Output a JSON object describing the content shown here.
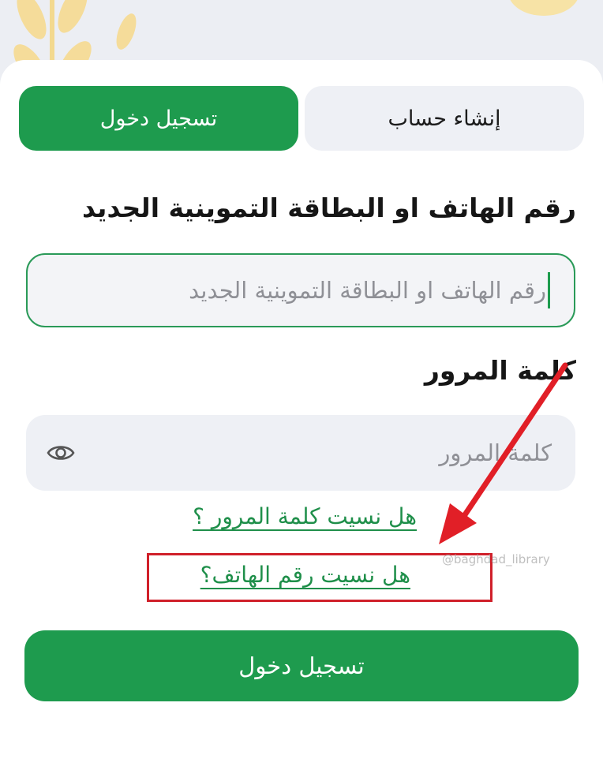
{
  "tabs": {
    "login": "تسجيل دخول",
    "signup": "إنشاء حساب"
  },
  "form": {
    "phone_label": "رقم الهاتف او البطاقة التموينية الجديد",
    "phone_placeholder": "رقم الهاتف او البطاقة التموينية الجديد",
    "password_label": "كلمة المرور",
    "password_placeholder": "كلمة المرور"
  },
  "links": {
    "forgot_password": "هل نسيت كلمة المرور ؟",
    "forgot_phone": "هل نسيت رقم الهاتف؟"
  },
  "login_button": "تسجيل دخول",
  "watermark": "@baghdad_library",
  "icons": {
    "password_toggle": "eye-icon"
  },
  "colors": {
    "primary": "#1e9b4e",
    "annotation": "#d0202a"
  }
}
